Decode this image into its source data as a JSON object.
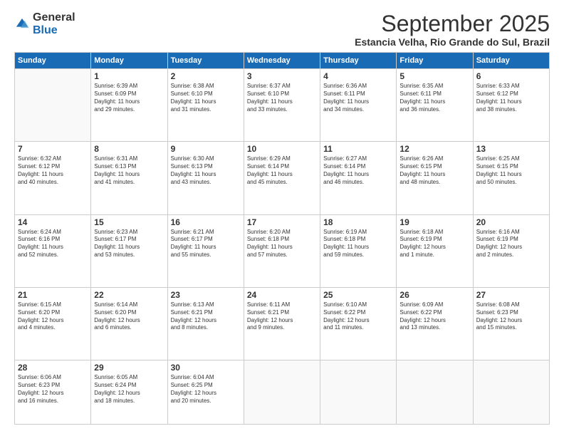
{
  "logo": {
    "general": "General",
    "blue": "Blue"
  },
  "header": {
    "month_title": "September 2025",
    "subtitle": "Estancia Velha, Rio Grande do Sul, Brazil"
  },
  "days_of_week": [
    "Sunday",
    "Monday",
    "Tuesday",
    "Wednesday",
    "Thursday",
    "Friday",
    "Saturday"
  ],
  "weeks": [
    [
      {
        "day": "",
        "info": ""
      },
      {
        "day": "1",
        "info": "Sunrise: 6:39 AM\nSunset: 6:09 PM\nDaylight: 11 hours\nand 29 minutes."
      },
      {
        "day": "2",
        "info": "Sunrise: 6:38 AM\nSunset: 6:10 PM\nDaylight: 11 hours\nand 31 minutes."
      },
      {
        "day": "3",
        "info": "Sunrise: 6:37 AM\nSunset: 6:10 PM\nDaylight: 11 hours\nand 33 minutes."
      },
      {
        "day": "4",
        "info": "Sunrise: 6:36 AM\nSunset: 6:11 PM\nDaylight: 11 hours\nand 34 minutes."
      },
      {
        "day": "5",
        "info": "Sunrise: 6:35 AM\nSunset: 6:11 PM\nDaylight: 11 hours\nand 36 minutes."
      },
      {
        "day": "6",
        "info": "Sunrise: 6:33 AM\nSunset: 6:12 PM\nDaylight: 11 hours\nand 38 minutes."
      }
    ],
    [
      {
        "day": "7",
        "info": "Sunrise: 6:32 AM\nSunset: 6:12 PM\nDaylight: 11 hours\nand 40 minutes."
      },
      {
        "day": "8",
        "info": "Sunrise: 6:31 AM\nSunset: 6:13 PM\nDaylight: 11 hours\nand 41 minutes."
      },
      {
        "day": "9",
        "info": "Sunrise: 6:30 AM\nSunset: 6:13 PM\nDaylight: 11 hours\nand 43 minutes."
      },
      {
        "day": "10",
        "info": "Sunrise: 6:29 AM\nSunset: 6:14 PM\nDaylight: 11 hours\nand 45 minutes."
      },
      {
        "day": "11",
        "info": "Sunrise: 6:27 AM\nSunset: 6:14 PM\nDaylight: 11 hours\nand 46 minutes."
      },
      {
        "day": "12",
        "info": "Sunrise: 6:26 AM\nSunset: 6:15 PM\nDaylight: 11 hours\nand 48 minutes."
      },
      {
        "day": "13",
        "info": "Sunrise: 6:25 AM\nSunset: 6:15 PM\nDaylight: 11 hours\nand 50 minutes."
      }
    ],
    [
      {
        "day": "14",
        "info": "Sunrise: 6:24 AM\nSunset: 6:16 PM\nDaylight: 11 hours\nand 52 minutes."
      },
      {
        "day": "15",
        "info": "Sunrise: 6:23 AM\nSunset: 6:17 PM\nDaylight: 11 hours\nand 53 minutes."
      },
      {
        "day": "16",
        "info": "Sunrise: 6:21 AM\nSunset: 6:17 PM\nDaylight: 11 hours\nand 55 minutes."
      },
      {
        "day": "17",
        "info": "Sunrise: 6:20 AM\nSunset: 6:18 PM\nDaylight: 11 hours\nand 57 minutes."
      },
      {
        "day": "18",
        "info": "Sunrise: 6:19 AM\nSunset: 6:18 PM\nDaylight: 11 hours\nand 59 minutes."
      },
      {
        "day": "19",
        "info": "Sunrise: 6:18 AM\nSunset: 6:19 PM\nDaylight: 12 hours\nand 1 minute."
      },
      {
        "day": "20",
        "info": "Sunrise: 6:16 AM\nSunset: 6:19 PM\nDaylight: 12 hours\nand 2 minutes."
      }
    ],
    [
      {
        "day": "21",
        "info": "Sunrise: 6:15 AM\nSunset: 6:20 PM\nDaylight: 12 hours\nand 4 minutes."
      },
      {
        "day": "22",
        "info": "Sunrise: 6:14 AM\nSunset: 6:20 PM\nDaylight: 12 hours\nand 6 minutes."
      },
      {
        "day": "23",
        "info": "Sunrise: 6:13 AM\nSunset: 6:21 PM\nDaylight: 12 hours\nand 8 minutes."
      },
      {
        "day": "24",
        "info": "Sunrise: 6:11 AM\nSunset: 6:21 PM\nDaylight: 12 hours\nand 9 minutes."
      },
      {
        "day": "25",
        "info": "Sunrise: 6:10 AM\nSunset: 6:22 PM\nDaylight: 12 hours\nand 11 minutes."
      },
      {
        "day": "26",
        "info": "Sunrise: 6:09 AM\nSunset: 6:22 PM\nDaylight: 12 hours\nand 13 minutes."
      },
      {
        "day": "27",
        "info": "Sunrise: 6:08 AM\nSunset: 6:23 PM\nDaylight: 12 hours\nand 15 minutes."
      }
    ],
    [
      {
        "day": "28",
        "info": "Sunrise: 6:06 AM\nSunset: 6:23 PM\nDaylight: 12 hours\nand 16 minutes."
      },
      {
        "day": "29",
        "info": "Sunrise: 6:05 AM\nSunset: 6:24 PM\nDaylight: 12 hours\nand 18 minutes."
      },
      {
        "day": "30",
        "info": "Sunrise: 6:04 AM\nSunset: 6:25 PM\nDaylight: 12 hours\nand 20 minutes."
      },
      {
        "day": "",
        "info": ""
      },
      {
        "day": "",
        "info": ""
      },
      {
        "day": "",
        "info": ""
      },
      {
        "day": "",
        "info": ""
      }
    ]
  ]
}
